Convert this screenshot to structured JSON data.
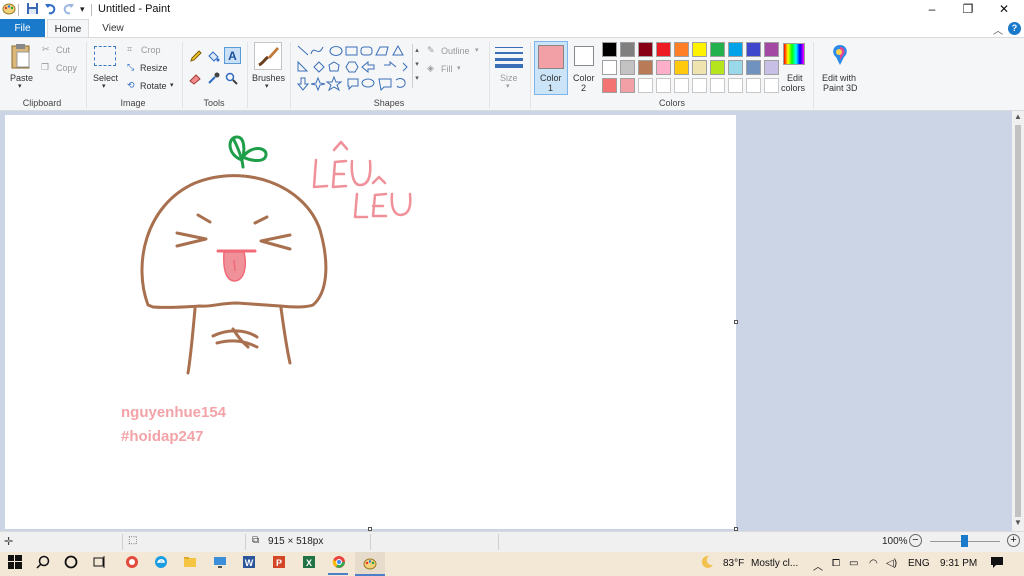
{
  "window": {
    "title": "Untitled - Paint",
    "minimize_glyph": "–",
    "restore_glyph": "❐",
    "close_glyph": "✕"
  },
  "tabs": {
    "file": "File",
    "home": "Home",
    "view": "View"
  },
  "ribbon": {
    "clipboard": {
      "paste": "Paste",
      "cut": "Cut",
      "copy": "Copy",
      "label": "Clipboard"
    },
    "image": {
      "select": "Select",
      "crop": "Crop",
      "resize": "Resize",
      "rotate": "Rotate",
      "label": "Image"
    },
    "tools": {
      "label": "Tools"
    },
    "brushes": {
      "label": "Brushes"
    },
    "shapes": {
      "outline": "Outline",
      "fill": "Fill",
      "label": "Shapes"
    },
    "size": {
      "label": "Size"
    },
    "color1": {
      "label": "Color",
      "num": "1",
      "value": "#f2a0a6"
    },
    "color2": {
      "label": "Color",
      "num": "2",
      "value": "#ffffff"
    },
    "edit_colors": {
      "line1": "Edit",
      "line2": "colors"
    },
    "paint3d": {
      "line1": "Edit with",
      "line2": "Paint 3D"
    },
    "colors_label": "Colors",
    "palette": [
      "#000000",
      "#7f7f7f",
      "#880015",
      "#ed1c24",
      "#ff7f27",
      "#fff200",
      "#22b14c",
      "#00a2e8",
      "#3f48cc",
      "#a349a4",
      "#ffffff",
      "#c3c3c3",
      "#b97a57",
      "#ffaec9",
      "#ffc90e",
      "#efe4b0",
      "#b5e61d",
      "#99d9ea",
      "#7092be",
      "#c8bfe7",
      "#f37373",
      "#f2a0a6",
      "",
      "",
      "",
      "",
      "",
      "",
      "",
      ""
    ]
  },
  "canvas": {
    "text_leu1": "LÊU",
    "text_leu2": "LÊU",
    "signature_line1": "nguyenhue154",
    "signature_line2": "#hoidap247",
    "brown": "#a8704f",
    "green": "#1e9e48",
    "pink": "#f0919a",
    "tongue": "#f06a78"
  },
  "status": {
    "dimensions": "915 × 518px",
    "zoom": "100%"
  },
  "taskbar": {
    "weather_temp": "83°F",
    "weather_desc": "Mostly cl...",
    "lang": "ENG",
    "time": "9:31 PM"
  }
}
